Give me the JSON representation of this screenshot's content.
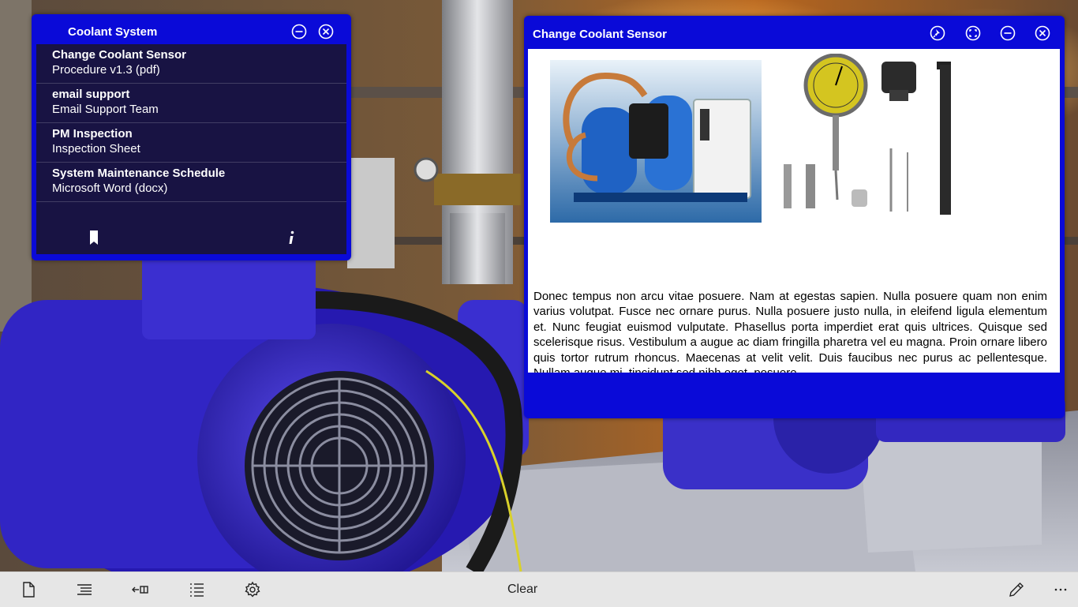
{
  "left_panel": {
    "title": "Coolant System",
    "items": [
      {
        "title": "Change Coolant Sensor",
        "subtitle": "Procedure v1.3 (pdf)"
      },
      {
        "title": "email support",
        "subtitle": "Email Support Team"
      },
      {
        "title": "PM Inspection",
        "subtitle": "Inspection Sheet"
      },
      {
        "title": "System Maintenance Schedule",
        "subtitle": "Microsoft Word (docx)"
      }
    ],
    "footer_icons": [
      "bookmark-icon",
      "info-icon"
    ]
  },
  "right_panel": {
    "title": "Change Coolant Sensor",
    "title_icons": [
      "pin-icon",
      "fullscreen-icon",
      "minimize-icon",
      "close-icon"
    ],
    "images": [
      "compressor-unit-image",
      "dial-indicator-tools-image"
    ],
    "body_text": "Donec tempus non arcu vitae posuere. Nam at egestas sapien. Nulla posuere quam non enim varius volutpat. Fusce nec ornare purus. Nulla posuere justo nulla, in eleifend ligula elementum et. Nunc feugiat euismod vulputate. Phasellus porta imperdiet erat quis ultrices. Quisque sed scelerisque risus. Vestibulum a augue ac diam fringilla pharetra vel eu magna. Proin ornare libero quis tortor rutrum rhoncus. Maecenas at velit velit. Duis faucibus nec purus ac pellentesque. Nullam augue mi, tincidunt sed nibh eget, posuere"
  },
  "appbar": {
    "left_icons": [
      "new-document-icon",
      "outline-icon",
      "back-to-list-icon",
      "list-icon",
      "settings-icon"
    ],
    "clear_label": "Clear",
    "right_icons": [
      "edit-pen-icon",
      "more-icon"
    ]
  },
  "colors": {
    "panel_blue": "#0a0ad8",
    "motor_blue": "#3d2fd6",
    "appbar_bg": "#e6e6e6"
  }
}
